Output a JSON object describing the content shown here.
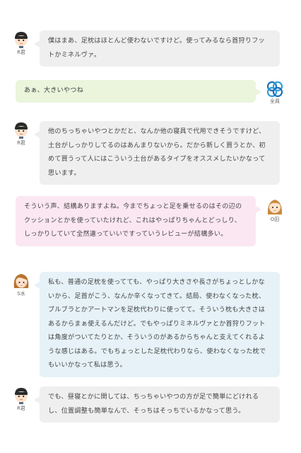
{
  "colors": {
    "bubble_gray": "#efefef",
    "bubble_green": "#eaf5dc",
    "bubble_pink": "#fbe7f1",
    "bubble_blue": "#e6f2f8",
    "text": "#444444"
  },
  "messages": [
    {
      "speaker": "R君",
      "avatar_icon": "boy-avatar-icon",
      "text": "僕はまあ、足枕はほとんど使わないですけど。使ってみるなら首狩りフットかミネルヴァ。"
    },
    {
      "speaker": "全員",
      "avatar_icon": "group-logo-icon",
      "text": "あぁ、大きいやつね"
    },
    {
      "speaker": "R君",
      "avatar_icon": "boy-avatar-icon",
      "text": "他のちっちゃいやつとかだと、なんか他の寝具で代用できそうですけど、土台がしっかりしてるのはあんまりないから。だから新しく買うとか、初めて買うって人にはこういう土台があるタイプをオススメしたいかなって思います。"
    },
    {
      "speaker": "O田",
      "avatar_icon": "girl-avatar-icon",
      "text": "そういう声、結構ありますよね。今までちょっと足を乗せるのはその辺のクッションとかを使っていたけれど、これはやっぱりちゃんとどっしり、しっかりしていて全然違っていいですっていうレビューが結構多い。"
    },
    {
      "speaker": "S水",
      "avatar_icon": "woman-avatar-icon",
      "text": "私も、普通の足枕を使ってても、やっぱり大きさや長さがちょっとしかないから、足首がこう、なんか辛くなってきて。結局、使わなくなった枕、ブルブラとかアートマンを足枕代わりに使ってて。そういう枕も大きさはあるからまぁ使えるんだけど。でもやっぱりミネルヴァとか首狩りフットは角度がついてたりとか、そういうのがあるからちゃんと支えてくれるような感じはある。でもちょっとした足枕代わりなら、使わなくなった枕でもいいかなって私は思う。"
    },
    {
      "speaker": "R君",
      "avatar_icon": "boy-avatar-icon",
      "text": "でも、昼寝とかに関しては、ちっちゃいやつの方が足で簡単にどけれるし、位置調整も簡単なんで、そっちはそっちでいるかなって思う。"
    }
  ]
}
